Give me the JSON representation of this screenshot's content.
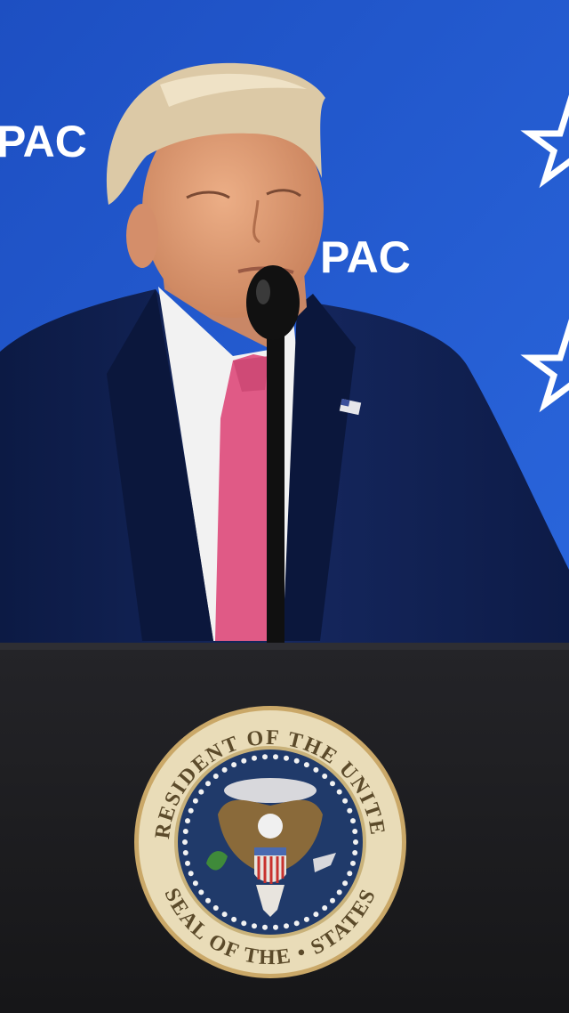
{
  "backdrop": {
    "logo_text_left": "PAC",
    "logo_text_center": "PAC",
    "star_icons": [
      "star-icon",
      "star-icon"
    ],
    "colors": {
      "background": "#1e56c8",
      "logo": "#ffffff"
    }
  },
  "speaker": {
    "suit_color": "#0f1f4d",
    "shirt_color": "#f2f2f2",
    "tie_color": "#e05a86",
    "hair_color": "#dcc9a6",
    "skin_color": "#e2a07a",
    "lapel_pin": "us-flag-pin"
  },
  "microphone": {
    "color": "#101010"
  },
  "podium": {
    "color": "#1c1c1f",
    "seal": {
      "ring_text": "SEAL OF THE PRESIDENT OF THE UNITED STATES",
      "colors": {
        "ring": "#e9dcb8",
        "field": "#203a6a",
        "eagle": "#8a6a3a"
      }
    }
  }
}
